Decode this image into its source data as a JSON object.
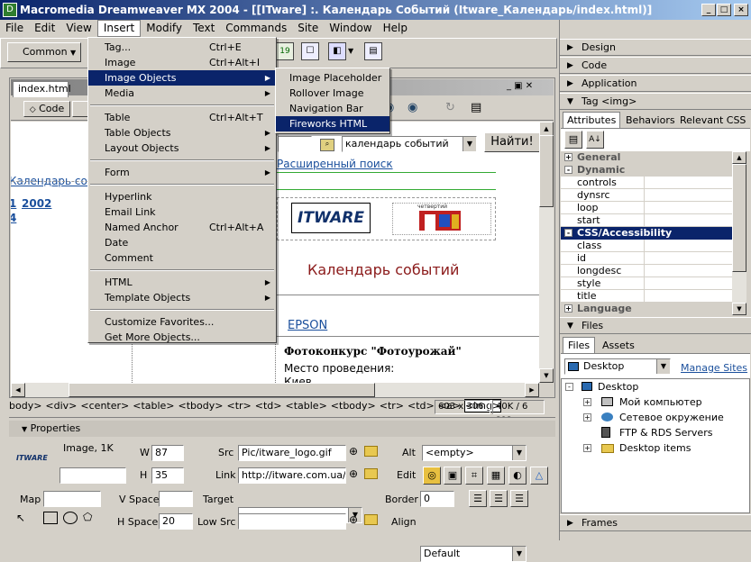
{
  "window": {
    "title": "Macromedia Dreamweaver MX 2004 - [[ITware] :. Календарь Событий (Itware_Календарь/index.html)]",
    "min": "_",
    "max": "□",
    "close": "×"
  },
  "menubar": [
    "File",
    "Edit",
    "View",
    "Insert",
    "Modify",
    "Text",
    "Commands",
    "Site",
    "Window",
    "Help"
  ],
  "toolbar": {
    "common": "Common"
  },
  "insert_menu": [
    {
      "label": "Tag...",
      "shortcut": "Ctrl+E"
    },
    {
      "label": "Image",
      "shortcut": "Ctrl+Alt+I"
    },
    {
      "label": "Image Objects",
      "arrow": "▶"
    },
    {
      "label": "Media",
      "arrow": "▶"
    },
    {
      "label": "Table",
      "shortcut": "Ctrl+Alt+T"
    },
    {
      "label": "Table Objects",
      "arrow": "▶"
    },
    {
      "label": "Layout Objects",
      "arrow": "▶"
    },
    {
      "label": "Form",
      "arrow": "▶"
    },
    {
      "label": "Hyperlink"
    },
    {
      "label": "Email Link"
    },
    {
      "label": "Named Anchor",
      "shortcut": "Ctrl+Alt+A"
    },
    {
      "label": "Date"
    },
    {
      "label": "Comment"
    },
    {
      "label": "HTML",
      "arrow": "▶"
    },
    {
      "label": "Template Objects",
      "arrow": "▶"
    },
    {
      "label": "Customize Favorites..."
    },
    {
      "label": "Get More Objects..."
    }
  ],
  "image_objects_menu": [
    "Image Placeholder",
    "Rollover Image",
    "Navigation Bar",
    "Fireworks HTML"
  ],
  "doc": {
    "tab": "index.html",
    "code": "Code",
    "link_calendar": "Календарь собы",
    "year_link": "2002",
    "num1": "1",
    "num2": "4",
    "search_value": "календарь событий",
    "search_button": "Найти!",
    "advanced_search": "Расширенный поиск",
    "logo_text": "ITWARE",
    "logo2_small": "четвертий",
    "heading": "Календарь событий",
    "epson": "EPSON",
    "photo_contest": "Фотоконкурс \"Фотоурожай\"",
    "venue": "Место проведения:",
    "city": "Киев"
  },
  "tag_selector": {
    "tags": [
      "body>",
      "<div>",
      "<center>",
      "<table>",
      "<tbody>",
      "<tr>",
      "<td>",
      "<table>",
      "<tbody>",
      "<tr>",
      "<td>",
      "<a>",
      "<img>"
    ],
    "size": "603 x 306",
    "weight": "40K / 6 sec"
  },
  "properties": {
    "title": "Properties",
    "type": "Image, 1K",
    "thumb": "ITWARE",
    "w_label": "W",
    "w": "87",
    "h_label": "H",
    "h": "35",
    "src_label": "Src",
    "src": "Pic/itware_logo.gif",
    "link_label": "Link",
    "link": "http://itware.com.ua/",
    "alt_label": "Alt",
    "alt": "<empty>",
    "edit_label": "Edit",
    "map_label": "Map",
    "vspace_label": "V Space",
    "vspace": "",
    "hspace_label": "H Space",
    "hspace": "20",
    "target_label": "Target",
    "target": "",
    "lowsrc_label": "Low Src",
    "lowsrc": "",
    "border_label": "Border",
    "border": "0",
    "align_label": "Align",
    "align": "Default"
  },
  "right_panels": {
    "design": "Design",
    "code": "Code",
    "application": "Application",
    "tag": "Tag <img>",
    "tabs": [
      "Attributes",
      "Behaviors",
      "Relevant CSS"
    ],
    "groups": [
      {
        "name": "General",
        "sign": "+",
        "attrs": []
      },
      {
        "name": "Dynamic",
        "sign": "-",
        "attrs": [
          "controls",
          "dynsrc",
          "loop",
          "start"
        ]
      },
      {
        "name": "CSS/Accessibility",
        "sign": "-",
        "attrs": [
          "class",
          "id",
          "longdesc",
          "style",
          "title"
        ]
      },
      {
        "name": "Language",
        "sign": "+",
        "attrs": []
      }
    ],
    "files": "Files",
    "files_tabs": [
      "Files",
      "Assets"
    ],
    "files_select": "Desktop",
    "manage_sites": "Manage Sites",
    "tree": [
      "Desktop",
      "Мой компьютер",
      "Сетевое окружение",
      "FTP & RDS Servers",
      "Desktop items"
    ],
    "frames": "Frames"
  }
}
